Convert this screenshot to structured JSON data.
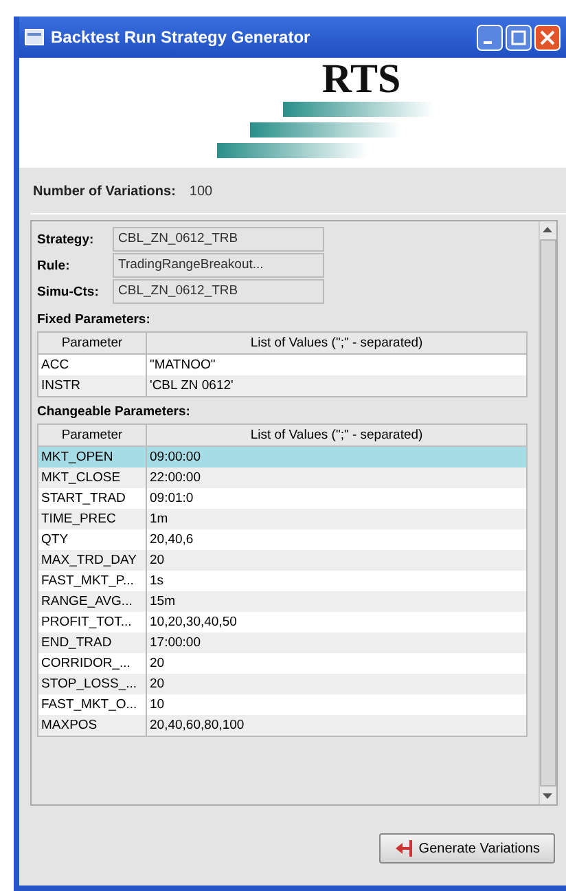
{
  "window": {
    "title": "Backtest Run Strategy Generator"
  },
  "logo": {
    "text": "RTS"
  },
  "variations": {
    "label": "Number of Variations:",
    "value": "100"
  },
  "info": [
    {
      "label": "Strategy:",
      "value": "CBL_ZN_0612_TRB"
    },
    {
      "label": "Rule:",
      "value": "TradingRangeBreakout..."
    },
    {
      "label": "Simu-Cts:",
      "value": "CBL_ZN_0612_TRB"
    }
  ],
  "fixed": {
    "title": "Fixed Parameters:",
    "columns": [
      "Parameter",
      "List of Values (\";\" - separated)"
    ],
    "rows": [
      {
        "name": "ACC",
        "value": "\"MATNOO\"",
        "selected": false
      },
      {
        "name": "INSTR",
        "value": "'CBL ZN 0612'",
        "selected": false
      }
    ]
  },
  "changeable": {
    "title": "Changeable Parameters:",
    "columns": [
      "Parameter",
      "List of Values (\";\" - separated)"
    ],
    "rows": [
      {
        "name": "MKT_OPEN",
        "value": "09:00:00",
        "selected": true
      },
      {
        "name": "MKT_CLOSE",
        "value": "22:00:00",
        "selected": false
      },
      {
        "name": "START_TRAD",
        "value": "09:01:0",
        "selected": false
      },
      {
        "name": "TIME_PREC",
        "value": "1m",
        "selected": false
      },
      {
        "name": "QTY",
        "value": "20,40,6",
        "selected": false
      },
      {
        "name": "MAX_TRD_DAY",
        "value": "20",
        "selected": false
      },
      {
        "name": "FAST_MKT_P...",
        "value": "1s",
        "selected": false
      },
      {
        "name": "RANGE_AVG...",
        "value": "15m",
        "selected": false
      },
      {
        "name": "PROFIT_TOT...",
        "value": "10,20,30,40,50",
        "selected": false
      },
      {
        "name": "END_TRAD",
        "value": "17:00:00",
        "selected": false
      },
      {
        "name": "CORRIDOR_...",
        "value": "20",
        "selected": false
      },
      {
        "name": "STOP_LOSS_...",
        "value": "20",
        "selected": false
      },
      {
        "name": "FAST_MKT_O...",
        "value": "10",
        "selected": false
      },
      {
        "name": "MAXPOS",
        "value": "20,40,60,80,100",
        "selected": false
      }
    ]
  },
  "button": {
    "label": "Generate Variations"
  }
}
